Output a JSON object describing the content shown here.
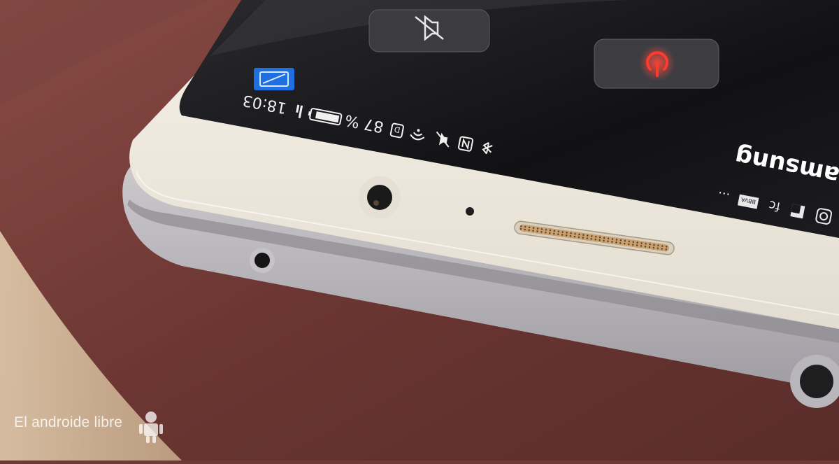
{
  "status_bar": {
    "time": "18:03",
    "battery_percent": "87 %",
    "battery_level": 0.87,
    "icons": [
      "signal-icon",
      "battery-icon",
      "data-icon",
      "wifi-icon",
      "nfc-icon",
      "mute-icon",
      "bluetooth-icon",
      "app-icon"
    ]
  },
  "quick_panel": {
    "mute_button_icon": "speaker-mute-icon",
    "power_button_icon": "power-icon"
  },
  "header": {
    "brand_fragment": "Samsung"
  },
  "notification_icons": [
    "instagram-icon",
    "fc-icon",
    "more-icon"
  ],
  "notification_icons_text": {
    "bbva": "BBVA",
    "ellipsis": "..."
  },
  "watermark": {
    "text": "El androide libre"
  },
  "colors": {
    "fabric": "#6e3a36",
    "phone_body": "#d9d7d8",
    "bezel": "#ece6dc",
    "screen": "#1a1a1c",
    "power_red": "#e8322a",
    "app_blue": "#1e6fe0"
  }
}
